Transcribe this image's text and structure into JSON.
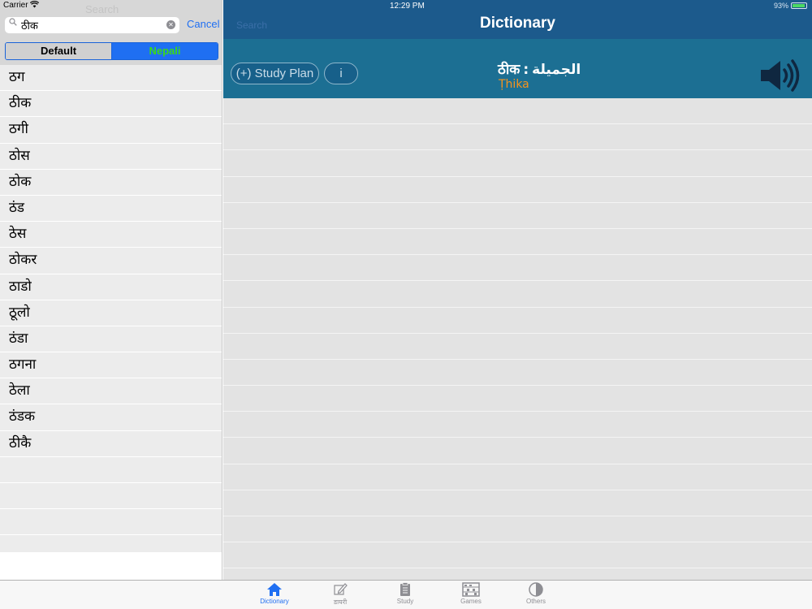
{
  "status_bar": {
    "carrier": "Carrier",
    "time": "12:29 PM",
    "battery": "93%"
  },
  "left_pane": {
    "ghost_title": "Search",
    "search": {
      "value": "ठीक",
      "placeholder": ""
    },
    "cancel_label": "Cancel",
    "segments": {
      "default": "Default",
      "nepali": "Nepali",
      "selected": "Nepali"
    },
    "words": [
      "ठग",
      "ठीक",
      "ठगी",
      "ठोस",
      "ठोक",
      "ठंड",
      "ठेस",
      "ठोकर",
      "ठाडो",
      "ठूलो",
      "ठंडा",
      "ठगना",
      "ठेला",
      "ठंडक",
      "ठीकै"
    ]
  },
  "right_pane": {
    "nav_search_label": "Search",
    "nav_title": "Dictionary",
    "study_plan_label": "(+) Study Plan",
    "info_label": "i",
    "headword": "ठीक",
    "separator": ":",
    "translation": "الجميلة",
    "transliteration": "Ṭhika"
  },
  "tabbar": {
    "items": [
      {
        "label": "Dictionary",
        "icon": "house-icon",
        "active": true
      },
      {
        "label": "डायरी",
        "icon": "edit-icon",
        "active": false
      },
      {
        "label": "Study",
        "icon": "clipboard-icon",
        "active": false
      },
      {
        "label": "Games",
        "icon": "abacus-icon",
        "active": false
      },
      {
        "label": "Others",
        "icon": "half-circle-icon",
        "active": false
      }
    ]
  },
  "colors": {
    "nav_blue": "#1c5a8c",
    "header_teal": "#1c6f93",
    "accent_blue": "#1f6ff2",
    "segment_text_green": "#3ad91a",
    "transliteration_orange": "#f7941d"
  }
}
